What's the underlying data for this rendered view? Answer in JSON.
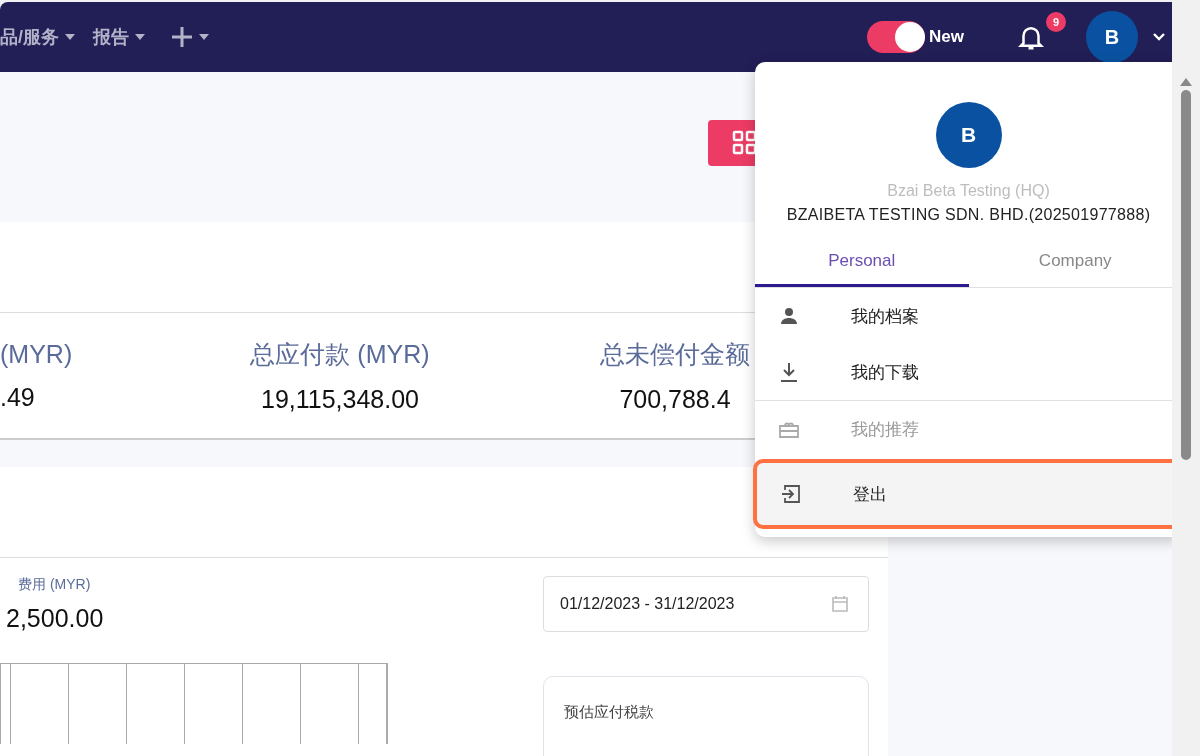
{
  "nav": {
    "menus": [
      {
        "label": "品/服务"
      },
      {
        "label": "报告"
      }
    ],
    "add_menu": {
      "caret": true
    },
    "toggle": {
      "label": "New",
      "on": true
    },
    "notifications": {
      "count": "9"
    },
    "avatar": {
      "initial": "B"
    }
  },
  "summary": [
    {
      "label": "(MYR)",
      "value": ".49"
    },
    {
      "label": "总应付款 (MYR)",
      "value": "19,115,348.00"
    },
    {
      "label": "总未偿付金额",
      "value": "700,788.4"
    }
  ],
  "expense": {
    "label": "费用 (MYR)",
    "value": "2,500.00",
    "date_range": "01/12/2023 - 31/12/2023",
    "tax_card": {
      "title": "预估应付税款"
    }
  },
  "profile_menu": {
    "avatar": "B",
    "company": "Bzai Beta Testing (HQ)",
    "entity": "BZAIBETA TESTING SDN. BHD.(202501977888)",
    "tabs": [
      {
        "label": "Personal",
        "selected": true
      },
      {
        "label": "Company",
        "selected": false
      }
    ],
    "groups": [
      [
        {
          "label": "我的档案",
          "kind": "person",
          "disabled": false,
          "highlighted": false
        },
        {
          "label": "我的下载",
          "kind": "download",
          "disabled": false,
          "highlighted": false
        }
      ],
      [
        {
          "label": "我的推荐",
          "kind": "gift",
          "disabled": true,
          "highlighted": false
        },
        {
          "label": "登出",
          "kind": "logout",
          "disabled": false,
          "highlighted": true
        }
      ]
    ]
  }
}
